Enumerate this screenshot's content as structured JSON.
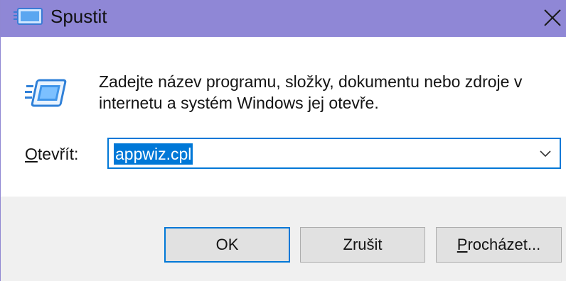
{
  "window": {
    "title": "Spustit",
    "title_icon": "run-dialog-icon",
    "close_icon": "close-icon"
  },
  "content": {
    "icon": "run-dialog-icon",
    "message": "Zadejte název programu, složky, dokumentu nebo zdroje v internetu a systém Windows jej otevře.",
    "open_label_underlined": "O",
    "open_label_rest": "tevřít:",
    "open_value": "appwiz.cpl",
    "dropdown_icon": "chevron-down-icon"
  },
  "buttons": {
    "ok": "OK",
    "cancel": "Zrušit",
    "browse_underlined": "P",
    "browse_rest": "rocházet..."
  },
  "colors": {
    "titlebar": "#8f87d6",
    "accent": "#0078d7",
    "footer": "#f0f0f0"
  }
}
